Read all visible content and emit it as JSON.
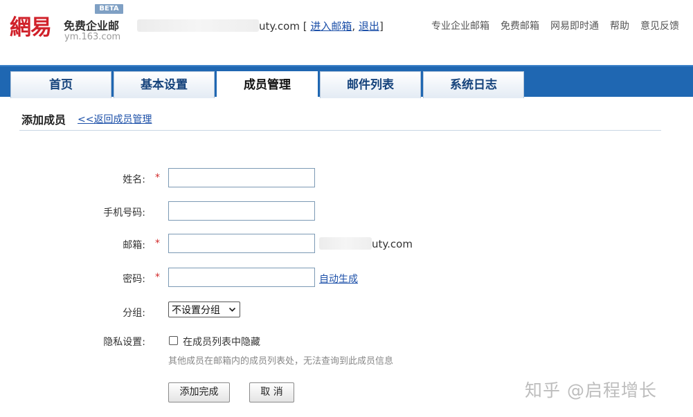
{
  "header": {
    "logo_text": "網易",
    "logo_sub": "免费企业邮",
    "logo_domain": "ym.163.com",
    "beta_badge": "BETA",
    "account_domain": "uty.com",
    "account_open": "[",
    "enter_mailbox": "进入邮箱",
    "account_sep": ",",
    "logout": "退出",
    "account_close": "]",
    "nav": [
      "专业企业邮箱",
      "免费邮箱",
      "网易即时通",
      "帮助",
      "意见反馈"
    ]
  },
  "tabs": [
    {
      "label": "首页"
    },
    {
      "label": "基本设置"
    },
    {
      "label": "成员管理"
    },
    {
      "label": "邮件列表"
    },
    {
      "label": "系统日志"
    }
  ],
  "active_tab": "成员管理",
  "page": {
    "title": "添加成员",
    "back_link": "<<返回成员管理"
  },
  "form": {
    "name_label": "姓名:",
    "phone_label": "手机号码:",
    "email_label": "邮箱:",
    "email_domain": "uty.com",
    "password_label": "密码:",
    "auto_generate": "自动生成",
    "group_label": "分组:",
    "group_selected": "不设置分组",
    "privacy_label": "隐私设置:",
    "privacy_option": "在成员列表中隐藏",
    "privacy_hint": "其他成员在邮箱内的成员列表处，无法查询到此成员信息",
    "required_mark": "*",
    "submit_label": "添加完成",
    "cancel_label": "取 消"
  },
  "watermark": "知乎 @启程增长",
  "colors": {
    "brand_red": "#d0212a",
    "tab_bar_blue": "#1f67b2",
    "link_blue": "#1b4fa8",
    "required_red": "#d12a2a"
  }
}
